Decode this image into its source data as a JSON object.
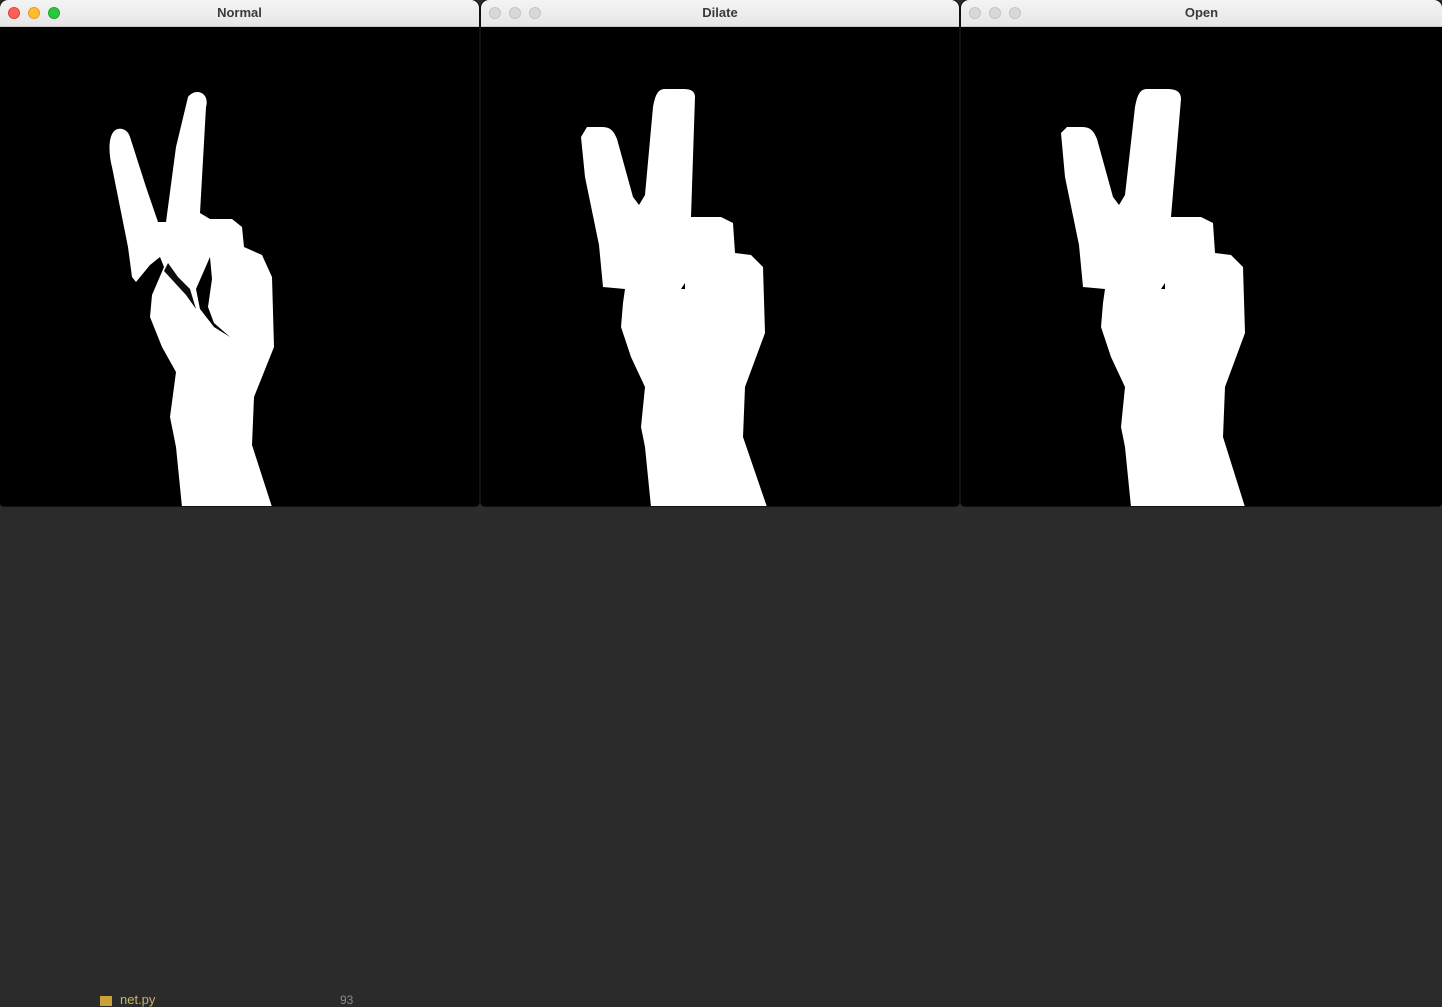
{
  "background": {
    "file_label": "net.py",
    "line_number": "93"
  },
  "windows": [
    {
      "title": "Normal",
      "active": true
    },
    {
      "title": "Dilate",
      "active": false
    },
    {
      "title": "Open",
      "active": false
    }
  ],
  "colors": {
    "traffic_close": "#ff5f57",
    "traffic_minimize": "#febc2e",
    "traffic_maximize": "#28c840",
    "canvas_background": "#000000",
    "mask_foreground": "#ffffff"
  }
}
